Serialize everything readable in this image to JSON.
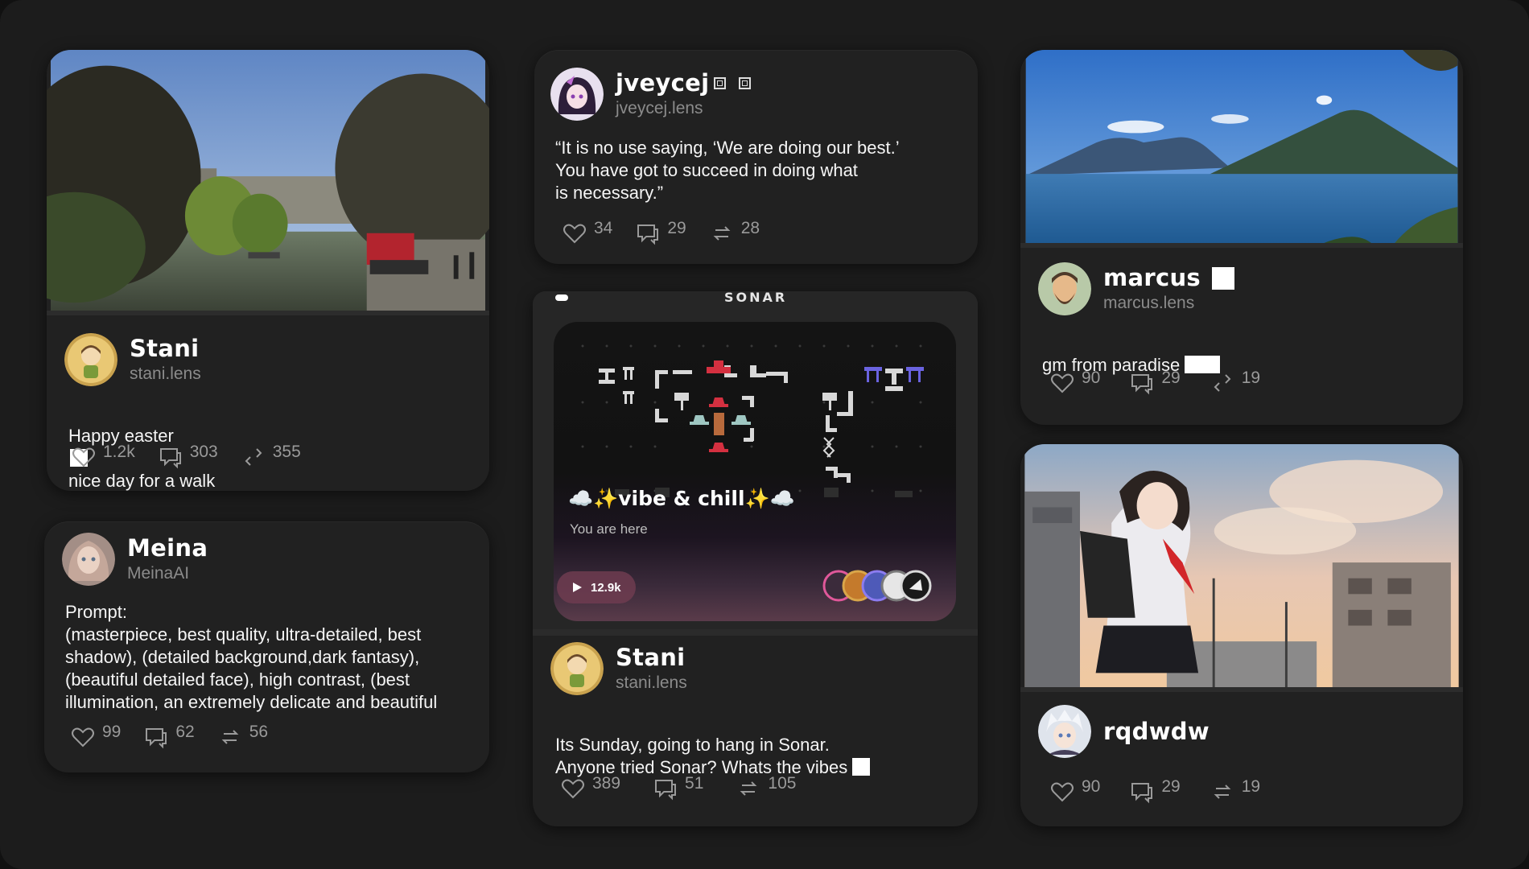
{
  "colors": {
    "background": "#1c1c1c",
    "card": "#212121",
    "muted": "#8b8b8b",
    "stat": "#9a9a9a"
  },
  "icons": {
    "like": "heart-icon",
    "comment": "comment-icon",
    "mirror": "mirror-icon",
    "play": "play-icon"
  },
  "posts": [
    {
      "id": "stani_easter",
      "name": "Stani",
      "handle": "stani.lens",
      "text_before": "Happy easter",
      "text_after": "nice day for a walk",
      "likes": "1.2k",
      "comments": "303",
      "mirrors": "355"
    },
    {
      "id": "meina",
      "name": "Meina",
      "handle": "MeinaAI",
      "text": "Prompt:\n(masterpiece, best quality, ultra-detailed, best shadow), (detailed background,dark fantasy), (beautiful detailed face), high contrast, (best illumination, an extremely delicate and beautiful",
      "likes": "99",
      "comments": "62",
      "mirrors": "56"
    },
    {
      "id": "jveycej",
      "name": "jveycej",
      "handle": "jveycej.lens",
      "text": "“It is no use saying, ‘We are doing our best.’\nYou have got to succeed in doing what\nis necessary.”",
      "likes": "34",
      "comments": "29",
      "mirrors": "28"
    },
    {
      "id": "stani_sonar",
      "name": "Stani",
      "handle": "stani.lens",
      "text": "Its Sunday, going to hang in Sonar.\nAnyone tried Sonar? Whats the vibes",
      "likes": "389",
      "comments": "51",
      "mirrors": "105",
      "sonar": {
        "title": "SONAR",
        "room": "☁️✨vibe & chill✨☁️",
        "status": "You are here",
        "plays": "12.9k"
      }
    },
    {
      "id": "marcus",
      "name": "marcus",
      "handle": "marcus.lens",
      "text": "gm from paradise",
      "likes": "90",
      "comments": "29",
      "mirrors": "19"
    },
    {
      "id": "rqdwdw",
      "name": "rqdwdw",
      "likes": "90",
      "comments": "29",
      "mirrors": "19"
    }
  ]
}
